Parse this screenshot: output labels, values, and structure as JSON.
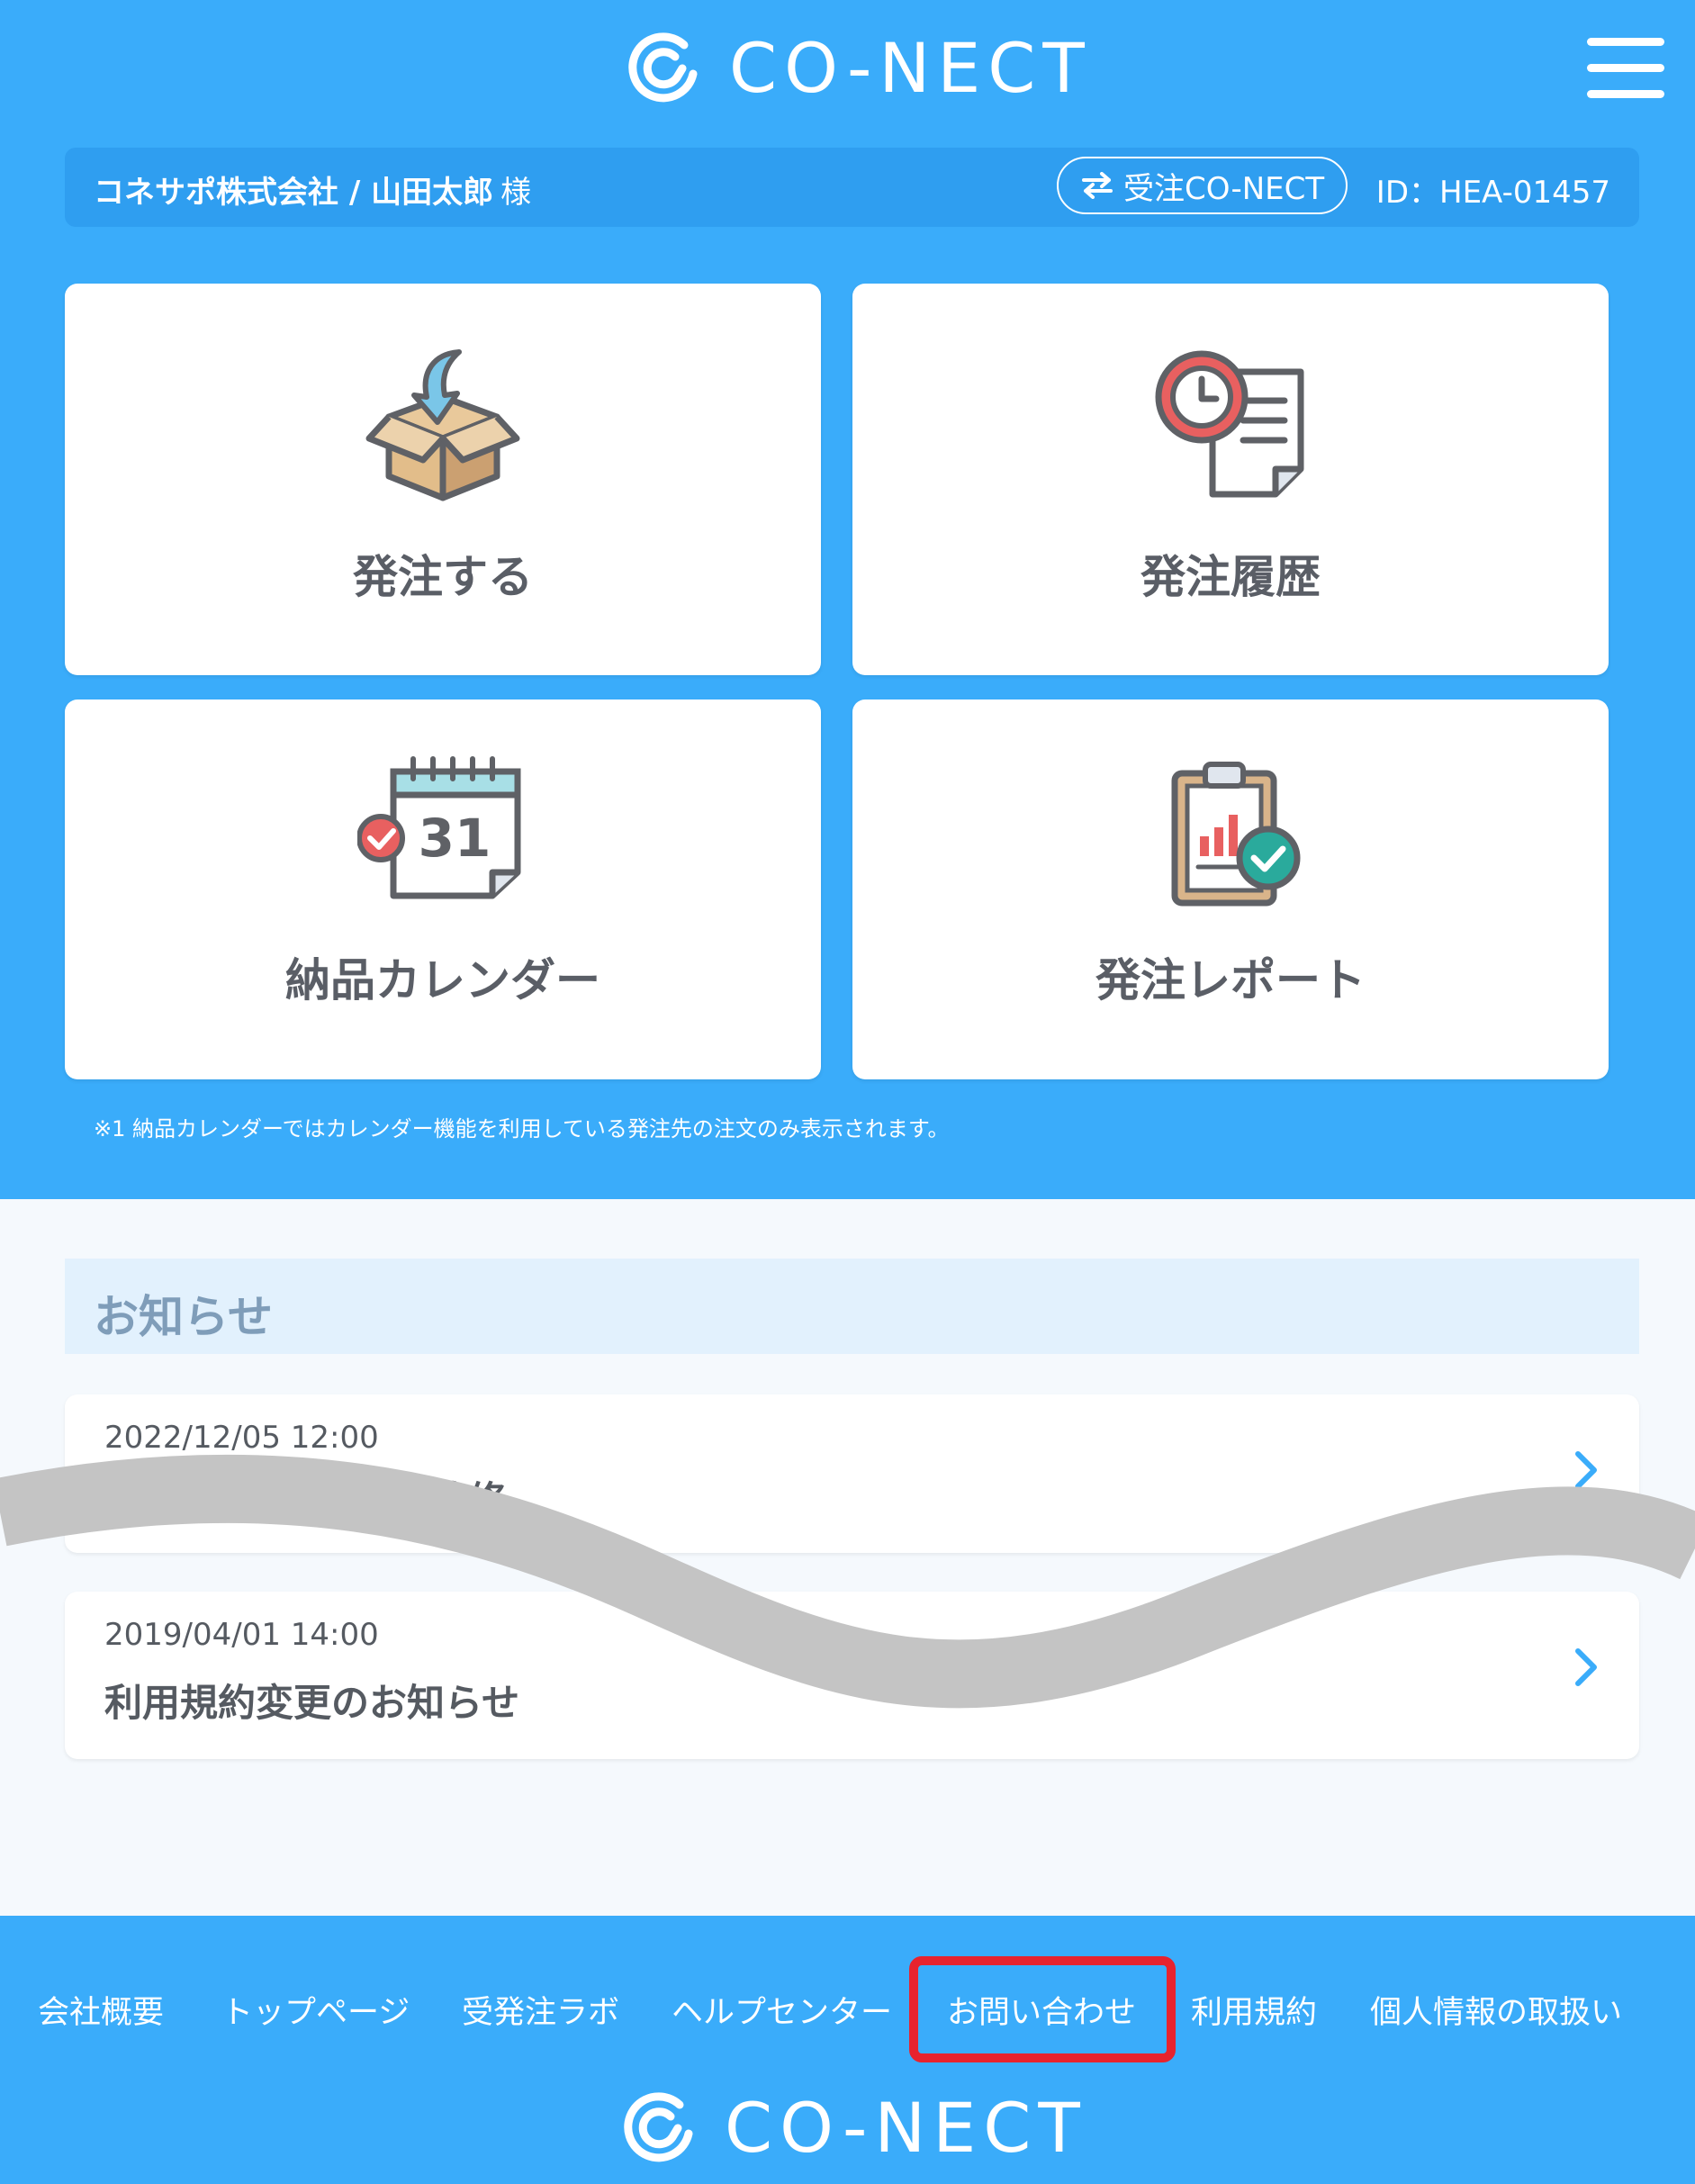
{
  "header": {
    "logo_text": "CO-NECT"
  },
  "user": {
    "name": "コネサポ株式会社 / 山田太郎",
    "honorific": "様",
    "switch_button": "受注CO-NECT",
    "id_label": "ID：HEA-01457"
  },
  "menu_cards": [
    {
      "label": "発注する",
      "icon": "box-download-icon"
    },
    {
      "label": "発注履歴",
      "icon": "clock-document-icon"
    },
    {
      "label": "納品カレンダー",
      "icon": "calendar-icon",
      "calendar_day": "31"
    },
    {
      "label": "発注レポート",
      "icon": "clipboard-report-icon"
    }
  ],
  "note": "※1 納品カレンダーではカレンダー機能を利用している発注先の注文のみ表示されます。",
  "news": {
    "heading": "お知らせ",
    "items": [
      {
        "date": "2022/12/05 12:00",
        "title": "はNEWを表示する改修"
      },
      {
        "date": "2019/04/01 14:00",
        "title": "利用規約変更のお知らせ"
      }
    ]
  },
  "footer": {
    "links": [
      "会社概要",
      "トップページ",
      "受発注ラボ",
      "ヘルプセンター",
      "お問い合わせ",
      "利用規約",
      "個人情報の取扱い"
    ],
    "highlighted_link": "お問い合わせ",
    "logo_text": "CO-NECT"
  },
  "colors": {
    "primary": "#3aacfa",
    "user_bar": "#2f9ef0",
    "news_head_bg": "#e2f1fd",
    "highlight_border": "#e7232e",
    "page_bg": "#f5f9fd"
  }
}
